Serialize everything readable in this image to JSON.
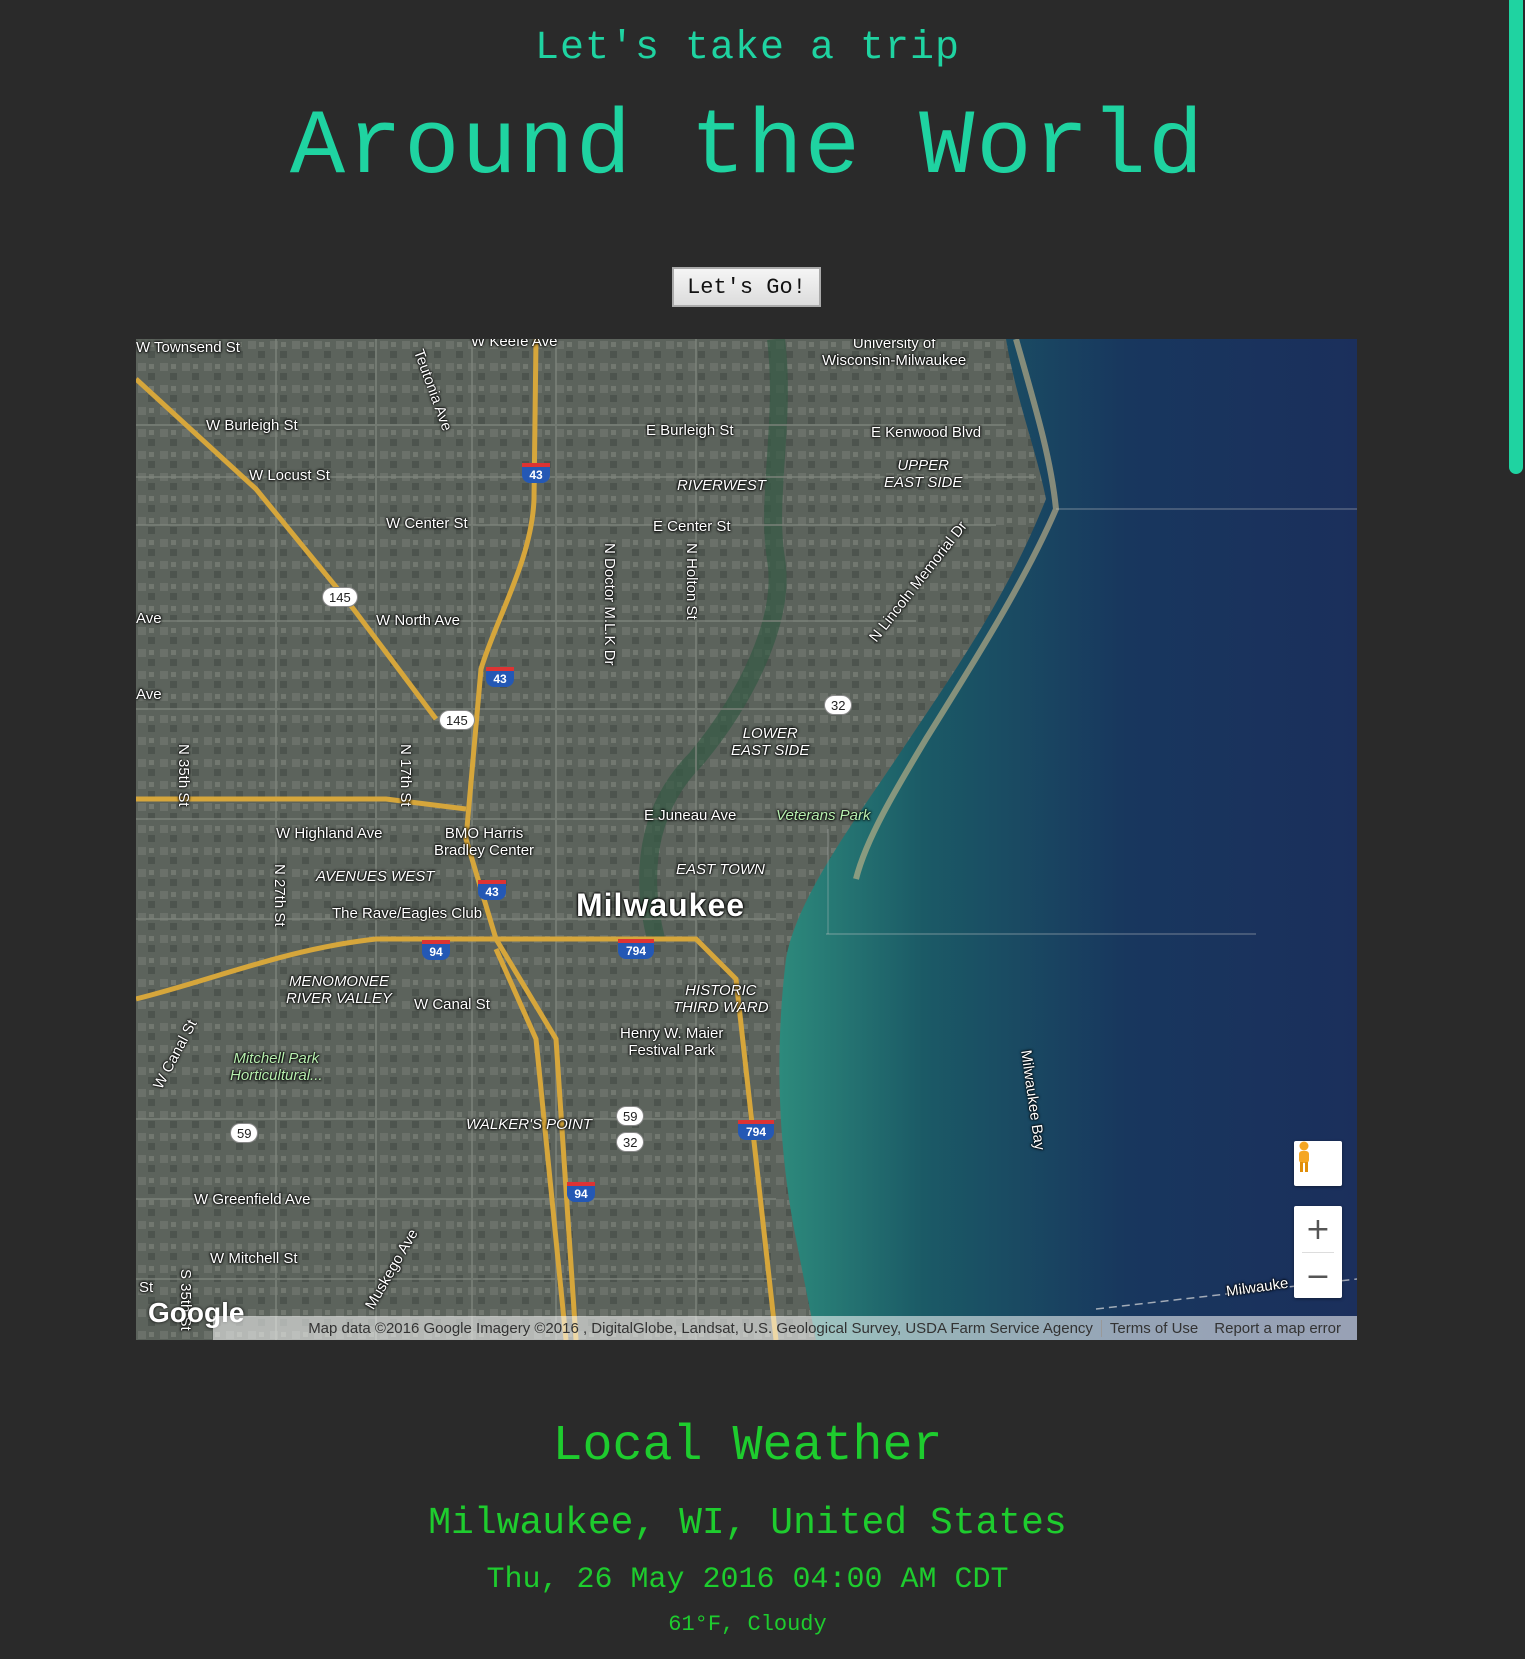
{
  "header": {
    "subtitle": "Let's take a trip",
    "title": "Around the World"
  },
  "go_button": {
    "label": "Let's Go!"
  },
  "map": {
    "labels": {
      "townsend": "W Townsend St",
      "keefe": "W Keefe Ave",
      "teutonia": "Teutonia Ave",
      "uwm": "University of\nWisconsin-Milwaukee",
      "burleigh_w": "W Burleigh St",
      "burleigh_e": "E Burleigh St",
      "kenwood": "E Kenwood Blvd",
      "upper_east": "UPPER\nEAST SIDE",
      "locust": "W Locust St",
      "riverwest": "RIVERWEST",
      "center_w": "W Center St",
      "center_e": "E Center St",
      "mlk": "N Doctor M.L.K Dr",
      "holton": "N Holton St",
      "north_ave": "W North Ave",
      "ave1": "Ave",
      "ave2": "Ave",
      "lincoln": "N Lincoln Memorial Dr",
      "lower_east": "LOWER\nEAST SIDE",
      "n35": "N 35th St",
      "n17": "N 17th St",
      "highland": "W Highland Ave",
      "bmo": "BMO Harris\nBradley Center",
      "juneau": "E Juneau Ave",
      "veterans": "Veterans Park",
      "avenues_west": "AVENUES WEST",
      "n27": "N 27th St",
      "east_town": "EAST TOWN",
      "rave": "The Rave/Eagles Club",
      "milwaukee": "Milwaukee",
      "menomonee": "MENOMONEE\nRIVER VALLEY",
      "canal": "W Canal St",
      "historic": "HISTORIC\nTHIRD WARD",
      "maier": "Henry W. Maier\nFestival Park",
      "w_canal": "W Canal St",
      "mitchell_park": "Mitchell Park\nHorticultural...",
      "milwaukee_bay": "Milwaukee Bay",
      "walkers": "WALKER'S POINT",
      "greenfield": "W Greenfield Ave",
      "mitchell": "W Mitchell St",
      "muskego": "Muskego Ave",
      "st": "St",
      "s35": "S 35th St",
      "milwaukee_edge": "Milwauke"
    },
    "shields": {
      "i43_a": "43",
      "i43_b": "43",
      "i43_c": "43",
      "i94_a": "94",
      "i94_b": "94",
      "i794_a": "794",
      "i794_b": "794"
    },
    "routes": {
      "r145_a": "145",
      "r145_b": "145",
      "r32_a": "32",
      "r32_b": "32",
      "r59_a": "59",
      "r59_b": "59"
    },
    "logo": "Google",
    "attribution": "Map data ©2016 Google Imagery ©2016 , DigitalGlobe, Landsat, U.S. Geological Survey, USDA Farm Service Agency",
    "terms": "Terms of Use",
    "report": "Report a map error",
    "zoom_in": "+",
    "zoom_out": "−"
  },
  "weather": {
    "heading": "Local Weather",
    "location": "Milwaukee, WI, United States",
    "datetime": "Thu, 26 May 2016 04:00 AM CDT",
    "condition": "61°F, Cloudy"
  },
  "colors": {
    "accent": "#1fd3a1",
    "weather": "#1ecc2e",
    "background": "#2a2a2a"
  }
}
